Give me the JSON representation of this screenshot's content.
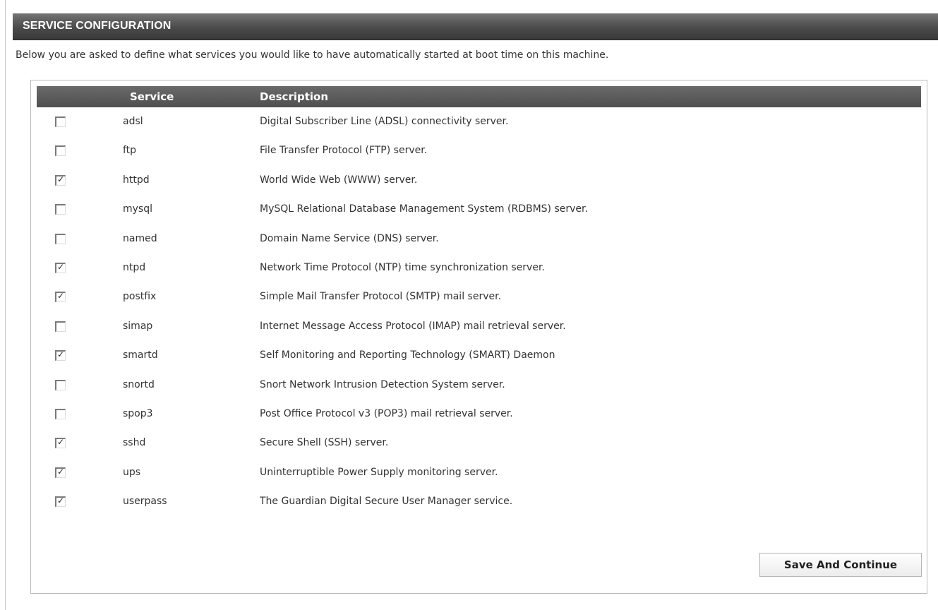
{
  "section": {
    "title": "SERVICE CONFIGURATION",
    "intro": "Below you are asked to define what services you would like to have automatically started at boot time on this machine."
  },
  "table": {
    "headers": {
      "service": "Service",
      "description": "Description"
    },
    "rows": [
      {
        "checked": false,
        "service": "adsl",
        "description": "Digital Subscriber Line (ADSL) connectivity server."
      },
      {
        "checked": false,
        "service": "ftp",
        "description": "File Transfer Protocol (FTP) server."
      },
      {
        "checked": true,
        "service": "httpd",
        "description": "World Wide Web (WWW) server."
      },
      {
        "checked": false,
        "service": "mysql",
        "description": "MySQL Relational Database Management System (RDBMS) server."
      },
      {
        "checked": false,
        "service": "named",
        "description": "Domain Name Service (DNS) server."
      },
      {
        "checked": true,
        "service": "ntpd",
        "description": "Network Time Protocol (NTP) time synchronization server."
      },
      {
        "checked": true,
        "service": "postfix",
        "description": "Simple Mail Transfer Protocol (SMTP) mail server."
      },
      {
        "checked": false,
        "service": "simap",
        "description": "Internet Message Access Protocol (IMAP) mail retrieval server."
      },
      {
        "checked": true,
        "service": "smartd",
        "description": "Self Monitoring and Reporting Technology (SMART) Daemon"
      },
      {
        "checked": false,
        "service": "snortd",
        "description": "Snort Network Intrusion Detection System server."
      },
      {
        "checked": false,
        "service": "spop3",
        "description": "Post Office Protocol v3 (POP3) mail retrieval server."
      },
      {
        "checked": true,
        "service": "sshd",
        "description": "Secure Shell (SSH) server."
      },
      {
        "checked": true,
        "service": "ups",
        "description": "Uninterruptible Power Supply monitoring server."
      },
      {
        "checked": true,
        "service": "userpass",
        "description": "The Guardian Digital Secure User Manager service."
      }
    ]
  },
  "actions": {
    "save_label": "Save And Continue"
  },
  "colors": {
    "header_bg": "#4a4a4a",
    "table_header_bg": "#5c5c5c",
    "panel_border": "#b9b9b9"
  },
  "icons": {
    "checkbox_checked": "check-icon"
  }
}
